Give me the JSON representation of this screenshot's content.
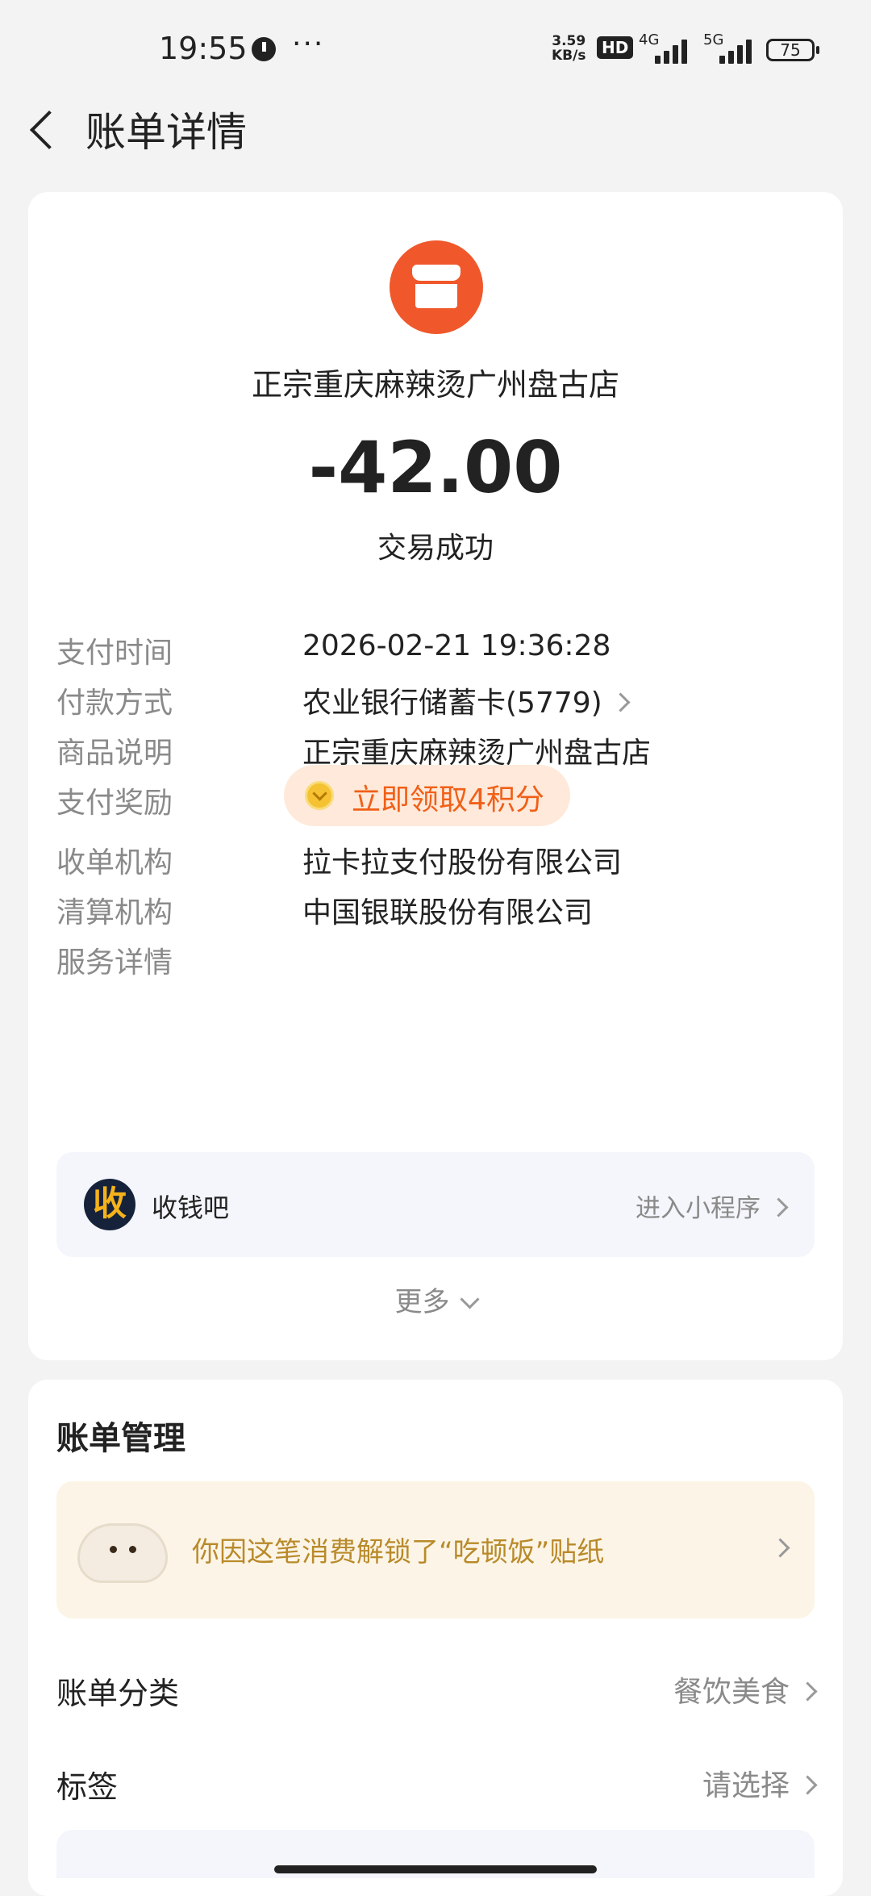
{
  "status_bar": {
    "time": "19:55",
    "more": "···",
    "net_speed_value": "3.59",
    "net_speed_unit": "KB/s",
    "hd": "HD",
    "sim1_net": "4G",
    "sim2_net": "5G",
    "battery": "75"
  },
  "header": {
    "title": "账单详情"
  },
  "transaction": {
    "merchant": "正宗重庆麻辣烫广州盘古店",
    "amount": "-42.00",
    "status": "交易成功",
    "accent_color": "#f0582b"
  },
  "details": [
    {
      "label": "支付时间",
      "value": "2026-02-21 19:36:28"
    },
    {
      "label": "付款方式",
      "value": "农业银行储蓄卡(5779)"
    },
    {
      "label": "商品说明",
      "value": "正宗重庆麻辣烫广州盘古店"
    },
    {
      "label": "支付奖励",
      "value": "立即领取4积分"
    },
    {
      "label": "收单机构",
      "value": "拉卡拉支付股份有限公司"
    },
    {
      "label": "清算机构",
      "value": "中国银联股份有限公司"
    },
    {
      "label": "服务详情"
    }
  ],
  "mini_program": {
    "logo_char": "收",
    "name": "收钱吧",
    "enter_label": "进入小程序"
  },
  "more_label": "更多",
  "bill_management": {
    "title": "账单管理",
    "banner_text": "你因这笔消费解锁了“吃顿饭”贴纸",
    "rows": [
      {
        "label": "账单分类",
        "value": "餐饮美食"
      },
      {
        "label": "标签",
        "value": "请选择"
      }
    ]
  }
}
